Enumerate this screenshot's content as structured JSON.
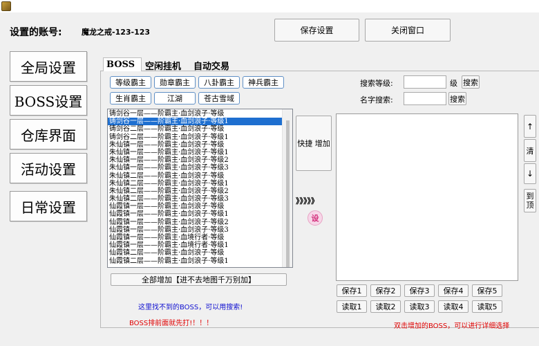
{
  "header": {
    "account_label": "设置的账号:",
    "account_value": "魔龙之戒-123-123",
    "save_btn": "保存设置",
    "close_btn": "关闭窗口"
  },
  "sidebar": {
    "items": [
      {
        "label": "全局设置"
      },
      {
        "label": "BOSS设置"
      },
      {
        "label": "仓库界面"
      },
      {
        "label": "活动设置"
      },
      {
        "label": "日常设置"
      }
    ]
  },
  "tabs": [
    "BOSS",
    "空闲挂机",
    "自动交易"
  ],
  "filters": [
    "等级霸主",
    "勋章霸主",
    "八卦霸主",
    "神兵霸主",
    "生肖霸主",
    "江湖",
    "苍古雪域"
  ],
  "search": {
    "level_label": "搜索等级:",
    "level_unit": "级",
    "level_btn": "搜索",
    "name_label": "名字搜索:",
    "name_btn": "搜索"
  },
  "boss_list": [
    "铸剑谷一层——阶霸主·血剑浪子·等级",
    "铸剑谷一层——阶霸主·血剑浪子·等级1",
    "铸剑谷二层——阶霸主·血剑浪子·等级",
    "铸剑谷二层——阶霸主·血剑浪子·等级1",
    "朱仙镇一层——阶霸主·血剑浪子·等级",
    "朱仙镇一层——阶霸主·血剑浪子·等级1",
    "朱仙镇一层——阶霸主·血剑浪子·等级2",
    "朱仙镇一层——阶霸主·血剑浪子·等级3",
    "朱仙镇二层——阶霸主·血剑浪子·等级",
    "朱仙镇二层——阶霸主·血剑浪子·等级1",
    "朱仙镇二层——阶霸主·血剑浪子·等级2",
    "朱仙镇二层——阶霸主·血剑浪子·等级3",
    "仙霞镇一层——阶霸主·血剑浪子·等级",
    "仙霞镇一层——阶霸主·血剑浪子·等级1",
    "仙霞镇一层——阶霸主·血剑浪子·等级2",
    "仙霞镇一层——阶霸主·血剑浪子·等级3",
    "仙霞镇一层——阶霸主·血境行者·等级",
    "仙霞镇一层——阶霸主·血境行者·等级1",
    "仙霞镇二层——阶霸主·血剑浪子·等级",
    "仙霞镇二层——阶霸主·血剑浪子·等级1"
  ],
  "selected_index": 1,
  "add_all_btn": "全部增加【进不去地图千万别加】",
  "quick_add_btn": "快捷 增加",
  "arrows_text": "》》》》》",
  "settings_icon_label": "设",
  "right_buttons": [
    "↑",
    "清",
    "↓",
    "到顶"
  ],
  "save_slots": [
    "保存1",
    "保存2",
    "保存3",
    "保存4",
    "保存5"
  ],
  "load_slots": [
    "读取1",
    "读取2",
    "读取3",
    "读取4",
    "读取5"
  ],
  "hint_search": "这里找不到的BOSS，可以用搜索!",
  "hint_priority": "BOSS排前面就先打!！！！",
  "hint_detail": "双击增加的BOSS，可以进行详细选择"
}
